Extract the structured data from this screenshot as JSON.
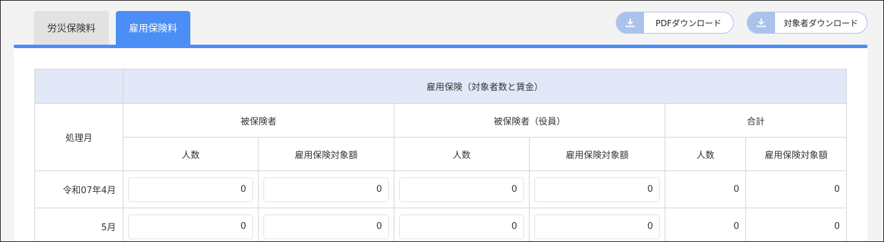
{
  "tabs": [
    {
      "label": "労災保険料",
      "active": false
    },
    {
      "label": "雇用保険料",
      "active": true
    }
  ],
  "buttons": {
    "pdf_download": "PDFダウンロード",
    "target_download": "対象者ダウンロード",
    "icon": "download-icon"
  },
  "colors": {
    "accent": "#4b8ef5",
    "header_bg": "#e2e8f7",
    "button_icon_bg": "#a9c3ea"
  },
  "table": {
    "group_header": "雇用保険（対象者数と賃金）",
    "row_header": "処理月",
    "groups": [
      "被保険者",
      "被保険者（役員）",
      "合計"
    ],
    "sub_headers": [
      "人数",
      "雇用保険対象額",
      "人数",
      "雇用保険対象額",
      "人数",
      "雇用保険対象額"
    ],
    "rows": [
      {
        "month": "令和07年4月",
        "insured_count": "0",
        "insured_amount": "0",
        "officer_count": "0",
        "officer_amount": "0",
        "total_count": "0",
        "total_amount": "0"
      },
      {
        "month": "5月",
        "insured_count": "0",
        "insured_amount": "0",
        "officer_count": "0",
        "officer_amount": "0",
        "total_count": "0",
        "total_amount": "0"
      }
    ]
  }
}
